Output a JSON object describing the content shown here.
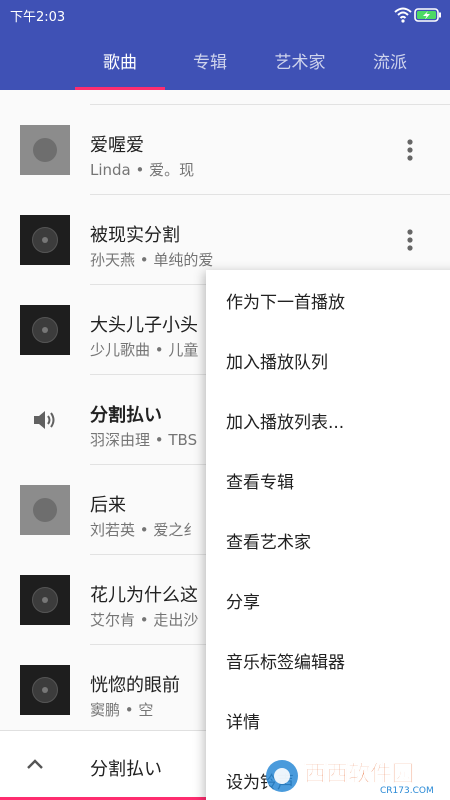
{
  "status_bar": {
    "time": "下午2:03",
    "icons": [
      "wifi-icon",
      "battery-charging-icon"
    ]
  },
  "tabs": [
    {
      "label": "歌曲",
      "active": true
    },
    {
      "label": "专辑",
      "active": false
    },
    {
      "label": "艺术家",
      "active": false
    },
    {
      "label": "流派",
      "active": false
    }
  ],
  "songs": [
    {
      "title": "爱喔爱",
      "subtitle": "Linda • 爱。现",
      "art": "grey",
      "playing": false
    },
    {
      "title": "被现实分割",
      "subtitle": "孙天燕 • 单纯的爱",
      "art": "dark",
      "playing": false
    },
    {
      "title": "大头儿子小头",
      "subtitle": "少儿歌曲 • 儿童",
      "art": "dark",
      "playing": false
    },
    {
      "title": "分割払い",
      "subtitle": "羽深由理 • TBS",
      "art": "none",
      "playing": true
    },
    {
      "title": "后来",
      "subtitle": "刘若英 • 爱之纟",
      "art": "grey",
      "playing": false
    },
    {
      "title": "花儿为什么这",
      "subtitle": "艾尔肯 • 走出沙",
      "art": "dark",
      "playing": false
    },
    {
      "title": "恍惚的眼前",
      "subtitle": "窦鹏 • 空",
      "art": "dark",
      "playing": false
    }
  ],
  "context_menu": {
    "items": [
      "作为下一首播放",
      "加入播放队列",
      "加入播放列表...",
      "查看专辑",
      "查看艺术家",
      "分享",
      "音乐标签编辑器",
      "详情",
      "设为铃声"
    ]
  },
  "now_playing": {
    "title": "分割払い"
  },
  "watermark": {
    "brand": "西西软件园",
    "domain": "CR173.COM"
  },
  "colors": {
    "primary": "#3f51b5",
    "accent": "#ff2d6f"
  }
}
